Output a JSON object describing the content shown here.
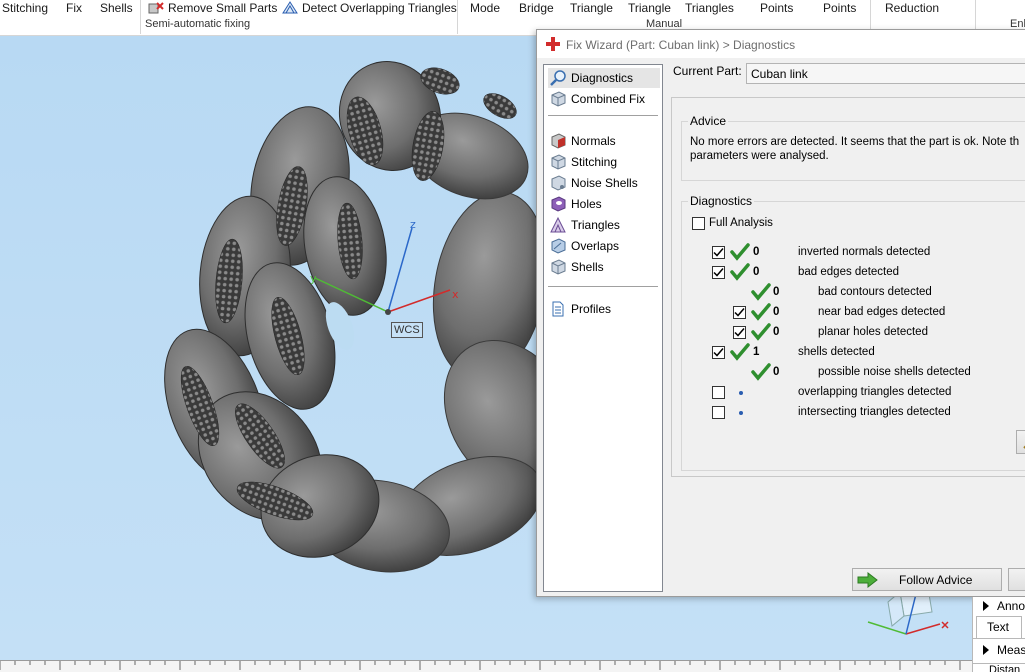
{
  "ribbon": {
    "stitching": "Stitching",
    "fix": "Fix",
    "shells": "Shells",
    "remove_small_parts": "Remove Small Parts",
    "detect_overlapping": "Detect Overlapping Triangles",
    "semi_auto_caption": "Semi-automatic fixing",
    "mode": "Mode",
    "bridge": "Bridge",
    "triangle1": "Triangle",
    "triangle2": "Triangle",
    "triangles": "Triangles",
    "manual_caption": "Manual",
    "points1": "Points",
    "points2": "Points",
    "reduction": "Reduction",
    "right_caption": "Enh"
  },
  "viewport": {
    "wcs_label": "WCS",
    "axis_x": "x",
    "axis_y": "y",
    "axis_z": "z"
  },
  "dialog": {
    "title": "Fix Wizard (Part: Cuban link) > Diagnostics",
    "current_part_label": "Current Part:",
    "current_part_value": "Cuban link",
    "nav": {
      "diagnostics": "Diagnostics",
      "combined_fix": "Combined Fix",
      "normals": "Normals",
      "stitching": "Stitching",
      "noise_shells": "Noise Shells",
      "holes": "Holes",
      "triangles": "Triangles",
      "overlaps": "Overlaps",
      "shells": "Shells",
      "profiles": "Profiles"
    },
    "advice": {
      "title": "Advice",
      "text": "No more errors are detected. It seems that the part is ok. Note th\nparameters were analysed."
    },
    "diagnostics": {
      "title": "Diagnostics",
      "full_analysis": "Full Analysis",
      "rows": [
        {
          "count": "0",
          "label": "inverted normals detected"
        },
        {
          "count": "0",
          "label": "bad edges detected"
        },
        {
          "count": "0",
          "label": "bad contours detected"
        },
        {
          "count": "0",
          "label": "near bad edges detected"
        },
        {
          "count": "0",
          "label": "planar holes detected"
        },
        {
          "count": "1",
          "label": "shells detected"
        },
        {
          "count": "0",
          "label": "possible noise shells detected"
        },
        {
          "count": "",
          "label": "overlapping triangles detected"
        },
        {
          "count": "",
          "label": "intersecting triangles detected"
        }
      ]
    },
    "follow_advice": "Follow Advice"
  },
  "side_panel": {
    "annotations": "Anno",
    "text_tab": "Text",
    "measurements": "Meas",
    "distance": "Distan"
  },
  "colors": {
    "accent_red": "#d22b2b",
    "check_green": "#2f8f2f",
    "viewport_bg": "#bcdcf2"
  }
}
